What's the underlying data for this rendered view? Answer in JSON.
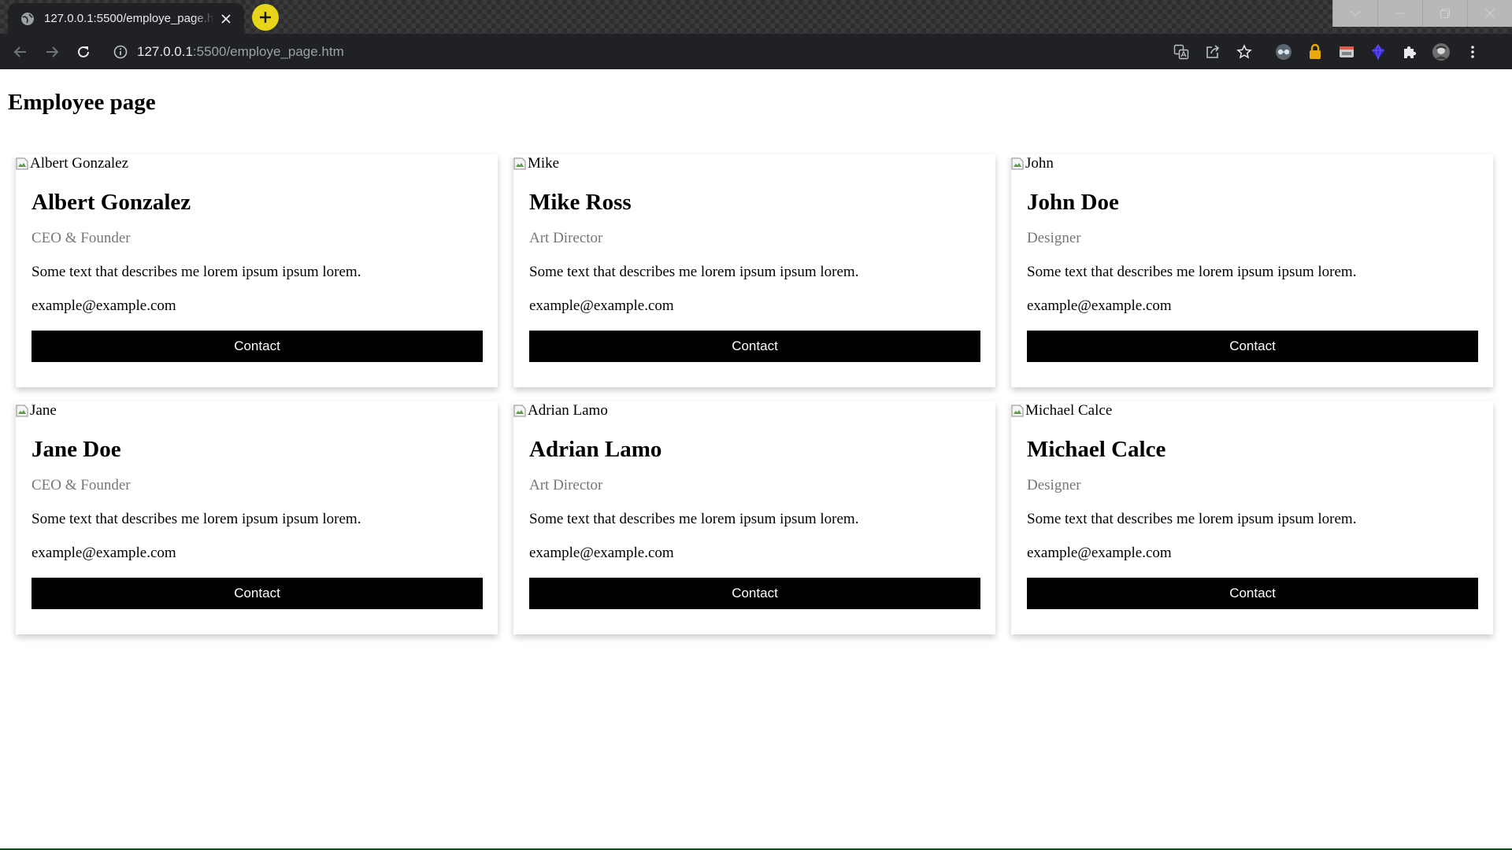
{
  "browser": {
    "tab_title": "127.0.0.1:5500/employe_page.htm",
    "url_host": "127.0.0.1",
    "url_path": ":5500/employe_page.htm",
    "accent_new_tab": "#e6d519"
  },
  "page": {
    "title": "Employee page",
    "contact_label": "Contact",
    "employees": [
      {
        "img_alt": "Albert Gonzalez",
        "name": "Albert Gonzalez",
        "role": "CEO & Founder",
        "description": "Some text that describes me lorem ipsum ipsum lorem.",
        "email": "example@example.com",
        "button": "Contact"
      },
      {
        "img_alt": "Mike",
        "name": "Mike Ross",
        "role": "Art Director",
        "description": "Some text that describes me lorem ipsum ipsum lorem.",
        "email": "example@example.com",
        "button": "Contact"
      },
      {
        "img_alt": "John",
        "name": "John Doe",
        "role": "Designer",
        "description": "Some text that describes me lorem ipsum ipsum lorem.",
        "email": "example@example.com",
        "button": "Contact"
      },
      {
        "img_alt": "Jane",
        "name": "Jane Doe",
        "role": "CEO & Founder",
        "description": "Some text that describes me lorem ipsum ipsum lorem.",
        "email": "example@example.com",
        "button": "Contact"
      },
      {
        "img_alt": "Adrian Lamo",
        "name": "Adrian Lamo",
        "role": "Art Director",
        "description": "Some text that describes me lorem ipsum ipsum lorem.",
        "email": "example@example.com",
        "button": "Contact"
      },
      {
        "img_alt": "Michael Calce",
        "name": "Michael Calce",
        "role": "Designer",
        "description": "Some text that describes me lorem ipsum ipsum lorem.",
        "email": "example@example.com",
        "button": "Contact"
      }
    ]
  }
}
